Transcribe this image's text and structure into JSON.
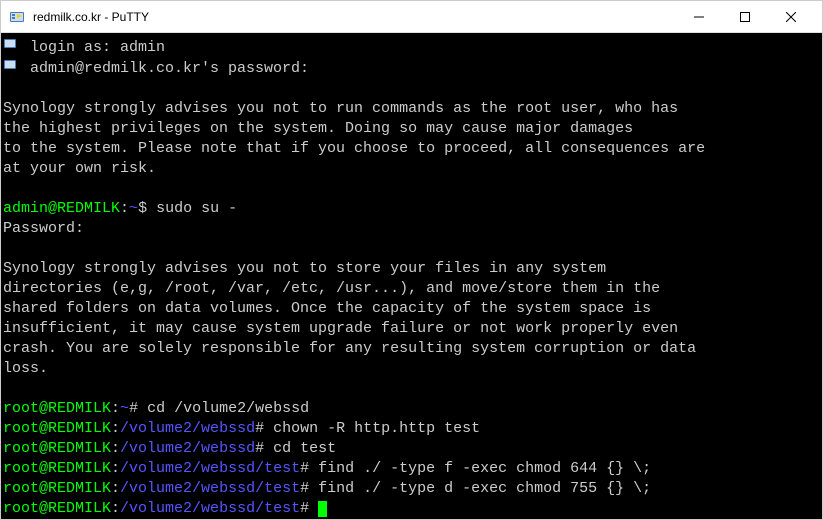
{
  "window": {
    "title": "redmilk.co.kr - PuTTY"
  },
  "terminal": {
    "login_prompt": "login as: admin",
    "password_prompt": "admin@redmilk.co.kr's password:",
    "warning1_l1": "Synology strongly advises you not to run commands as the root user, who has",
    "warning1_l2": "the highest privileges on the system. Doing so may cause major damages",
    "warning1_l3": "to the system. Please note that if you choose to proceed, all consequences are",
    "warning1_l4": "at your own risk.",
    "prompt1_user": "admin@REDMILK",
    "prompt1_sep": ":",
    "prompt1_path": "~",
    "prompt1_sym": "$ ",
    "cmd1": "sudo su -",
    "password2": "Password:",
    "warning2_l1": "Synology strongly advises you not to store your files in any system",
    "warning2_l2": "directories (e,g, /root, /var, /etc, /usr...), and move/store them in the",
    "warning2_l3": "shared folders on data volumes. Once the capacity of the system space is",
    "warning2_l4": "insufficient, it may cause system upgrade failure or not work properly even",
    "warning2_l5": "crash. You are solely responsible for any resulting system corruption or data",
    "warning2_l6": "loss.",
    "root_user": "root@REDMILK",
    "root_sep": ":",
    "root_path_home": "~",
    "root_sym": "# ",
    "cmd2": "cd /volume2/webssd",
    "root_path_webssd": "/volume2/webssd",
    "cmd3": "chown -R http.http test",
    "cmd4": "cd test",
    "root_path_test": "/volume2/webssd/test",
    "cmd5": "find ./ -type f -exec chmod 644 {} \\;",
    "cmd6": "find ./ -type d -exec chmod 755 {} \\;"
  }
}
